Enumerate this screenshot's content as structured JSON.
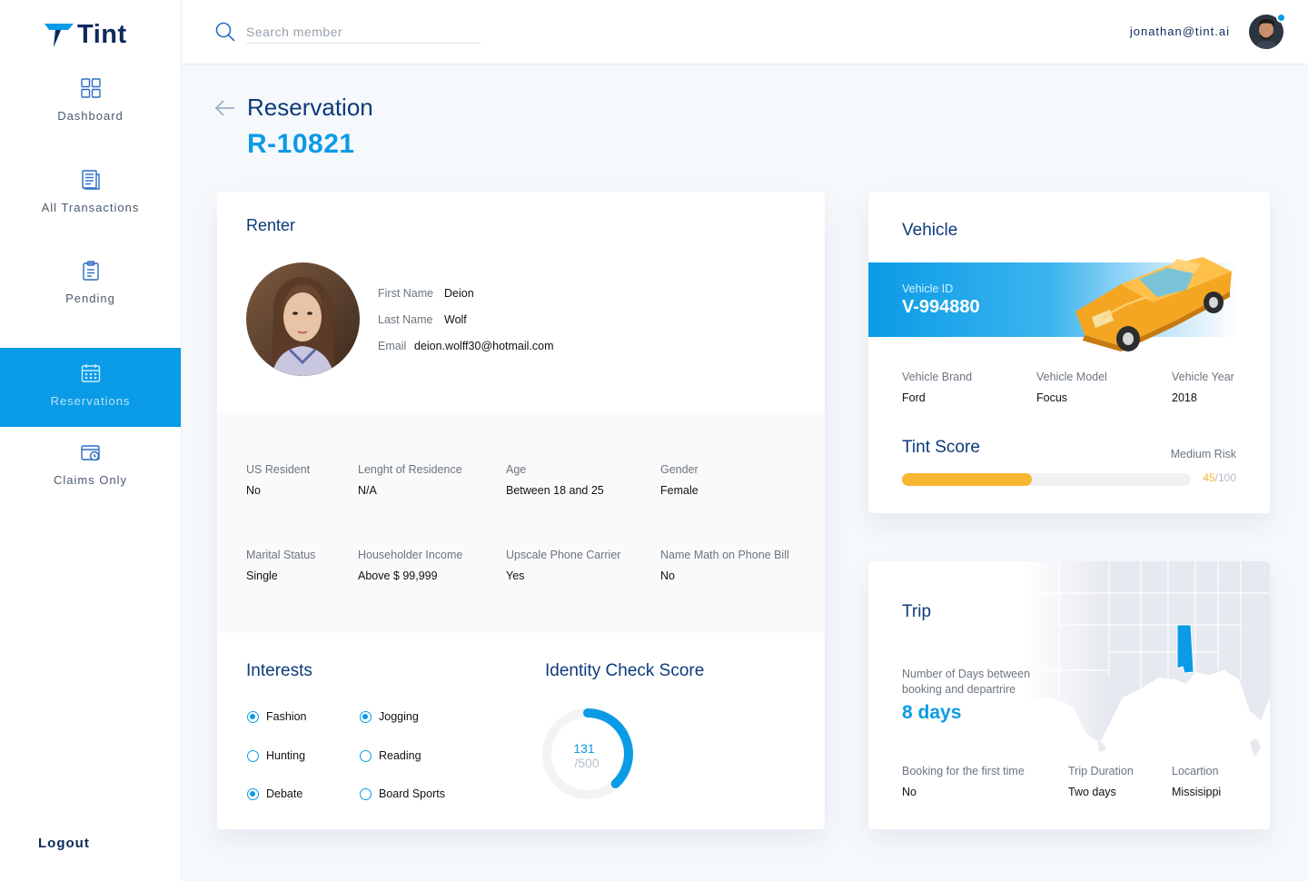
{
  "app": {
    "name": "Tint"
  },
  "colors": {
    "accent": "#0a9be6",
    "navy": "#0d3b7a",
    "score": "#f7b733"
  },
  "sidebar": {
    "items": [
      {
        "label": "Dashboard",
        "icon": "grid-icon",
        "active": false
      },
      {
        "label": "All Transactions",
        "icon": "document-icon",
        "active": false
      },
      {
        "label": "Pending",
        "icon": "clipboard-icon",
        "active": false
      },
      {
        "label": "Reservations",
        "icon": "calendar-icon",
        "active": true
      },
      {
        "label": "Claims Only",
        "icon": "wallet-clock-icon",
        "active": false
      }
    ],
    "logout": "Logout"
  },
  "header": {
    "search_placeholder": "Search member",
    "user_email": "jonathan@tint.ai"
  },
  "page": {
    "title": "Reservation",
    "id": "R-10821"
  },
  "renter": {
    "title": "Renter",
    "first_name_label": "First Name",
    "first_name": "Deion",
    "last_name_label": "Last Name",
    "last_name": "Wolf",
    "email_label": "Email",
    "email": "deion.wolff30@hotmail.com",
    "details": [
      {
        "label": "US Resident",
        "value": "No"
      },
      {
        "label": "Lenght of Residence",
        "value": "N/A"
      },
      {
        "label": "Age",
        "value": "Between 18 and 25"
      },
      {
        "label": "Gender",
        "value": "Female"
      },
      {
        "label": "Marital Status",
        "value": "Single"
      },
      {
        "label": "Householder Income",
        "value": "Above $ 99,999"
      },
      {
        "label": "Upscale Phone Carrier",
        "value": "Yes"
      },
      {
        "label": "Name Math on Phone Bill",
        "value": "No"
      }
    ]
  },
  "interests": {
    "title": "Interests",
    "items": [
      {
        "label": "Fashion",
        "checked": true
      },
      {
        "label": "Jogging",
        "checked": true
      },
      {
        "label": "Hunting",
        "checked": false
      },
      {
        "label": "Reading",
        "checked": false
      },
      {
        "label": "Debate",
        "checked": true
      },
      {
        "label": "Board Sports",
        "checked": false
      }
    ]
  },
  "identity": {
    "title": "Identity Check Score",
    "score": "131",
    "max": "/500",
    "score_value": 131,
    "score_max": 500
  },
  "vehicle": {
    "title": "Vehicle",
    "id_label": "Vehicle ID",
    "id": "V-994880",
    "brand_label": "Vehicle Brand",
    "brand": "Ford",
    "model_label": "Vehicle Model",
    "model": "Focus",
    "year_label": "Vehicle Year",
    "year": "2018"
  },
  "tint_score": {
    "title": "Tint Score",
    "risk": "Medium Risk",
    "score": "45",
    "max": "/100",
    "score_value": 45,
    "score_max": 100
  },
  "trip": {
    "title": "Trip",
    "days_label": "Number of Days between booking and departrire",
    "days_value": "8 days",
    "first_time_label": "Booking for the first time",
    "first_time": "No",
    "duration_label": "Trip Duration",
    "duration": "Two days",
    "location_label": "Locartion",
    "location": "Missisippi"
  }
}
